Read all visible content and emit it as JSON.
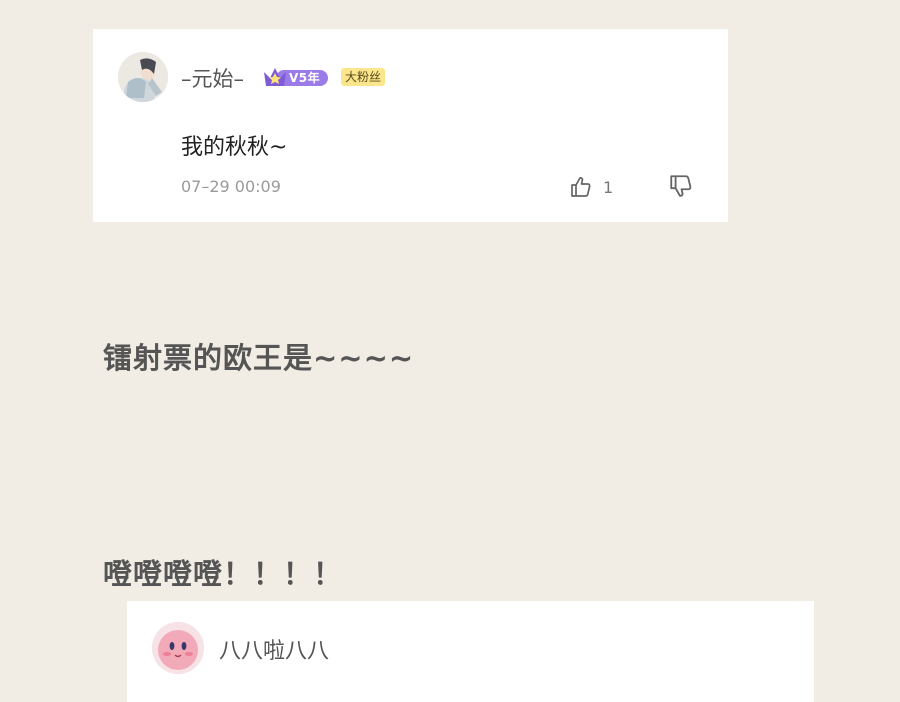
{
  "comment": {
    "username": "–元始–",
    "vip_badge": "V5年",
    "fan_badge": "大粉丝",
    "text": "我的秋秋~",
    "timestamp": "07–29 00:09",
    "like_count": "1"
  },
  "captions": {
    "line_1": "镭射票的欧王是~~~~",
    "line_2": "噔噔噔噔！！！！"
  },
  "reply": {
    "username": "八八啦八八"
  },
  "colors": {
    "background": "#f1ede4",
    "card": "#ffffff",
    "vip_purple": "#9b7be8",
    "fan_badge": "#fbe68c"
  }
}
